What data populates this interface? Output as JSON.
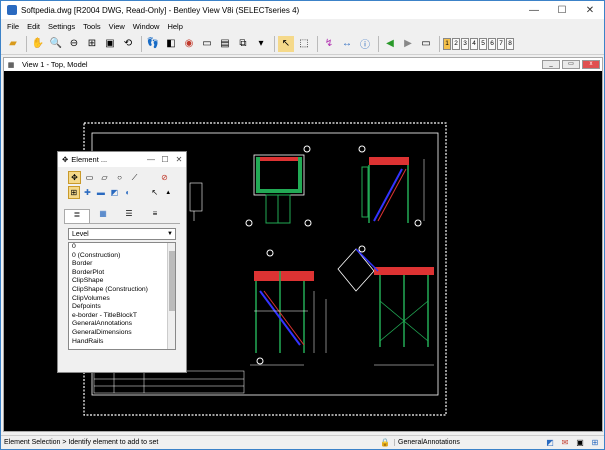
{
  "window": {
    "title": "Softpedia.dwg [R2004 DWG, Read-Only] - Bentley View V8i (SELECTseries 4)",
    "minimize_label": "—",
    "maximize_label": "☐",
    "close_label": "✕"
  },
  "menu": {
    "items": [
      "File",
      "Edit",
      "Settings",
      "Tools",
      "View",
      "Window",
      "Help"
    ]
  },
  "toolbar": {
    "view_numbers": [
      "1",
      "2",
      "3",
      "4",
      "5",
      "6",
      "7",
      "8"
    ],
    "active_view": "1",
    "accent": "#f5c04a"
  },
  "view": {
    "title": "View 1 - Top, Model",
    "background": "#000000"
  },
  "element_panel": {
    "title": "Element ...",
    "level_header": "Level",
    "levels": [
      "0",
      "0 (Construction)",
      "Border",
      "BorderPlot",
      "ClipShape",
      "ClipShape (Construction)",
      "ClipVolumes",
      "Defpoints",
      "e-border - TitleBlockT",
      "GeneralAnnotations",
      "GeneralDimensions",
      "HandRails"
    ]
  },
  "status": {
    "message": "Element Selection > Identify element to add to set",
    "active_level": "GeneralAnnotations"
  },
  "icons": [
    "app-icon",
    "file-open-icon",
    "pan-icon",
    "zoom-icon",
    "fit-view-icon",
    "select-icon",
    "info-icon",
    "back-icon",
    "forward-icon",
    "lock-icon"
  ]
}
